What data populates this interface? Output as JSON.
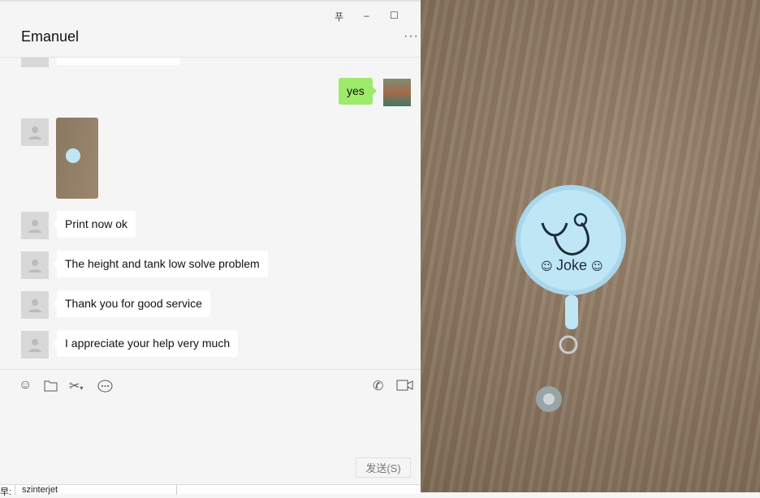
{
  "window": {
    "pin_icon": "pin-icon",
    "minimize": "–",
    "maximize": "☐",
    "close": "×"
  },
  "header": {
    "title": "Emanuel",
    "more": "···"
  },
  "messages": [
    {
      "from": "contact",
      "text": "yes"
    },
    {
      "from": "contact",
      "type": "image"
    },
    {
      "from": "contact",
      "text": "Print now ok"
    },
    {
      "from": "contact",
      "text": "The height and tank low solve problem"
    },
    {
      "from": "contact",
      "text": "Thank you for good service"
    },
    {
      "from": "contact",
      "text": "I appreciate your help very much"
    }
  ],
  "my_message": "yes",
  "toolbar": {
    "icons": [
      "emoji-icon",
      "folder-icon",
      "scissors-icon",
      "chat-history-icon",
      "phone-icon",
      "video-icon"
    ]
  },
  "send_button": "发送(S)",
  "status_bar": {
    "label": "早:",
    "value": "szinterjet"
  },
  "photo": {
    "badge_text": "Joke",
    "colors": {
      "badge": "#bfe6f5",
      "bubble_mine": "#9eea6a"
    }
  }
}
